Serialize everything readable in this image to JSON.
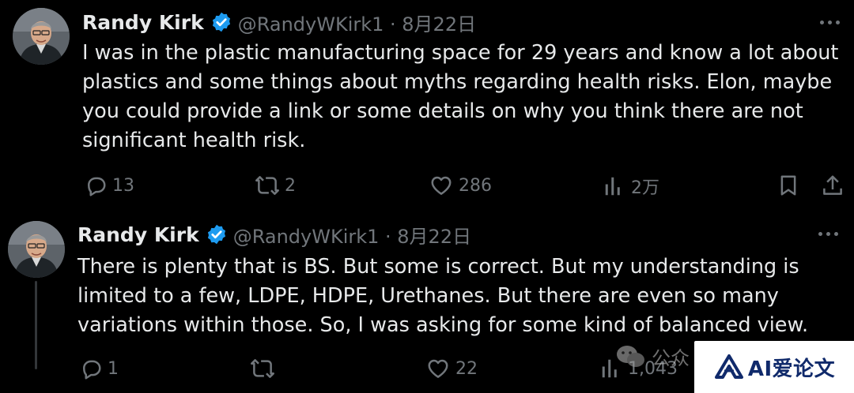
{
  "tweets": [
    {
      "author": "Randy Kirk",
      "handle_meta": "@RandyWKirk1 · 8月22日",
      "text_lines": [
        "I was in the plastic manufacturing space for 29 years and know a lot about",
        "plastics and some things about myths regarding health risks. Elon, maybe",
        "you could provide a link or some details on why you think there are not",
        "significant health risk."
      ],
      "replies": "13",
      "reposts": "2",
      "likes": "286",
      "views": "2万"
    },
    {
      "author": "Randy Kirk",
      "handle_meta": "@RandyWKirk1 · 8月22日",
      "text_lines": [
        "There is plenty that is BS. But some is correct. But my understanding is",
        "limited to a few, LDPE, HDPE, Urethanes. But there are even so many",
        "variations within those. So, I was asking for some kind of balanced view."
      ],
      "replies": "1",
      "reposts": "",
      "likes": "22",
      "views": "1,043"
    }
  ],
  "watermark": {
    "wechat_text": "公众",
    "badge_text": "AI爱论文"
  },
  "icons": [
    "reply-icon",
    "repost-icon",
    "like-icon",
    "views-icon",
    "bookmark-icon",
    "share-icon",
    "verified-icon",
    "more-icon",
    "wechat-icon",
    "badge-logo-icon"
  ],
  "colors": {
    "background": "#000000",
    "text": "#e7e9ea",
    "secondary": "#71767b",
    "verified": "#1d9bf0",
    "thread_line": "#333639",
    "badge_text": "#102a6b"
  }
}
